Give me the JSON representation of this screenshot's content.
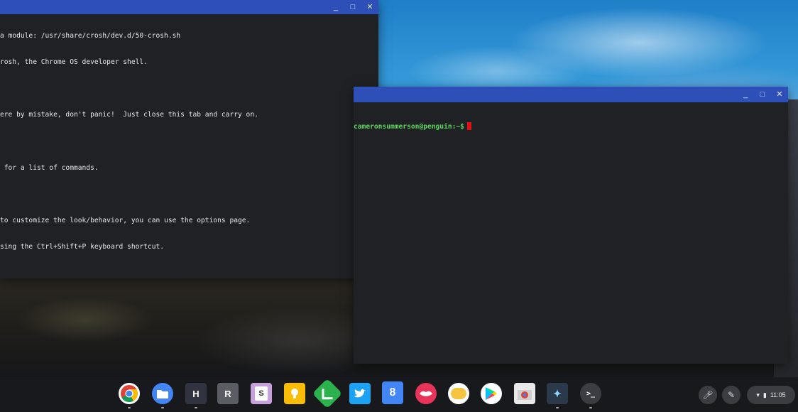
{
  "crosh": {
    "lines": [
      "a module: /usr/share/crosh/dev.d/50-crosh.sh",
      "rosh, the Chrome OS developer shell.",
      "",
      "ere by mistake, don't panic!  Just close this tab and carry on.",
      "",
      " for a list of commands.",
      "",
      "to customize the look/behavior, you can use the options page.",
      "sing the Ctrl+Shift+P keyboard shortcut."
    ]
  },
  "penguin": {
    "prompt": "cameronsummerson@penguin:~$"
  },
  "window_controls": {
    "minimize": "_",
    "maximize": "□",
    "close": "✕"
  },
  "shelf": {
    "apps": [
      {
        "name": "chrome-icon",
        "label": "",
        "color": "#ffffff"
      },
      {
        "name": "files-icon",
        "label": "",
        "color": "#4285f4"
      },
      {
        "name": "app-h-icon",
        "label": "H",
        "color": "#2f3440"
      },
      {
        "name": "app-r-icon",
        "label": "R",
        "color": "#5a5d63"
      },
      {
        "name": "slides-icon",
        "label": "S",
        "color": "#c9a0dc"
      },
      {
        "name": "keep-icon",
        "label": "",
        "color": "#fbbc04"
      },
      {
        "name": "feedly-icon",
        "label": "",
        "color": "#2bb24c"
      },
      {
        "name": "twitter-icon",
        "label": "",
        "color": "#1da1f2"
      },
      {
        "name": "calendar-icon",
        "label": "8",
        "color": "#4285f4"
      },
      {
        "name": "lips-icon",
        "label": "",
        "color": "#e8335a"
      },
      {
        "name": "mysay-pro-icon",
        "label": "",
        "color": "#f5c542"
      },
      {
        "name": "play-store-icon",
        "label": "",
        "color": "#ffffff"
      },
      {
        "name": "chrome-store-icon",
        "label": "",
        "color": "#e9e9e9"
      },
      {
        "name": "sparkle-app-icon",
        "label": "",
        "color": "#2b3a4a"
      },
      {
        "name": "terminal-icon",
        "label": ">_",
        "color": "#3c3d42"
      }
    ],
    "clock": "11:05"
  }
}
